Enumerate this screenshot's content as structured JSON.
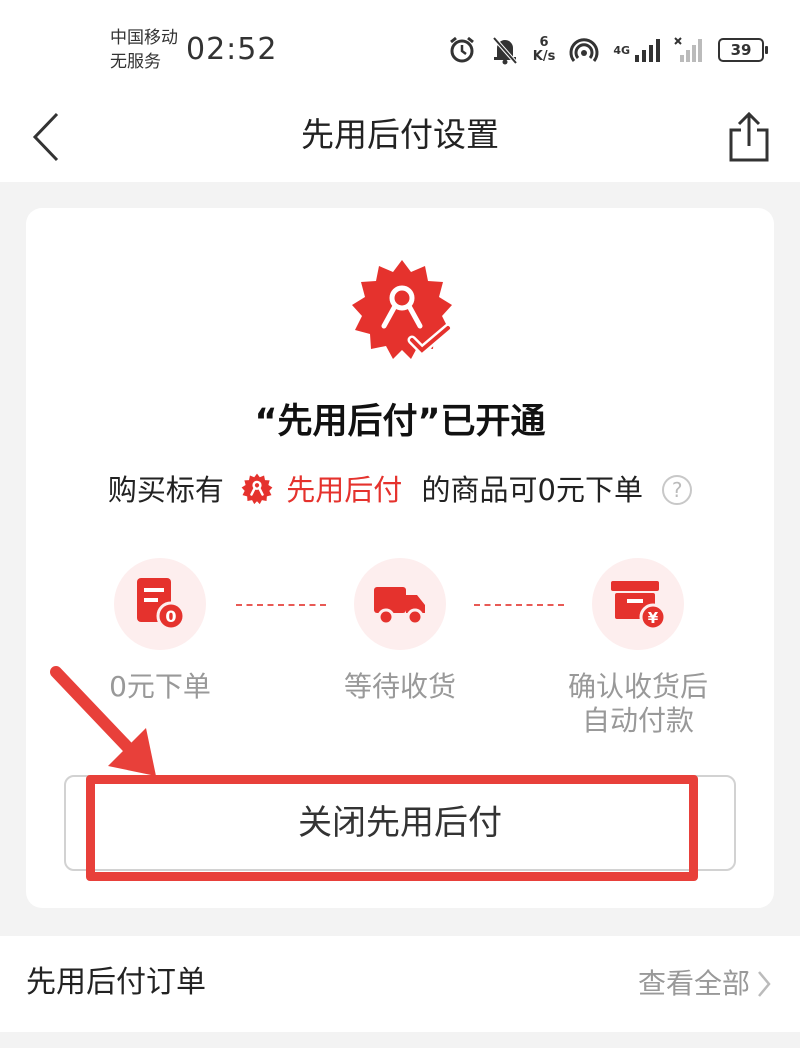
{
  "status_bar": {
    "carrier_line1": "中国移动",
    "carrier_line2": "无服务",
    "time": "02:52",
    "speed_value": "6",
    "speed_unit": "K/s",
    "network_label": "4G",
    "battery": "39"
  },
  "nav": {
    "title": "先用后付设置"
  },
  "card": {
    "headline": "“先用后付”已开通",
    "subline_before": "购买标有",
    "subline_highlight": "先用后付",
    "subline_after": "的商品可0元下单",
    "help_symbol": "?",
    "steps": [
      {
        "line1": "0元下单",
        "line2": "",
        "badge_text": "0"
      },
      {
        "line1": "等待收货",
        "line2": ""
      },
      {
        "line1": "确认收货后",
        "line2": "自动付款",
        "badge_text": "¥"
      }
    ],
    "close_button_label": "关闭先用后付"
  },
  "orders": {
    "title": "先用后付订单",
    "view_all": "查看全部"
  },
  "colors": {
    "brand_red": "#e5322d",
    "annotation_red": "#e8403a",
    "step_bg": "#fdeeee",
    "muted_text": "#999999"
  },
  "icons": {
    "back": "chevron-left-icon",
    "share": "share-icon",
    "badge": "pay-later-badge-icon",
    "step1": "order-document-icon",
    "step2": "delivery-truck-icon",
    "step3": "payment-box-icon",
    "help": "help-circle-icon",
    "chevron": "chevron-right-icon"
  }
}
